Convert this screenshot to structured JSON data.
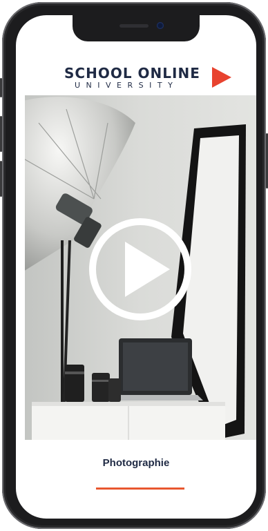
{
  "logo": {
    "main": "SCHOOL ONLINE",
    "sub": "UNIVERSITY",
    "accent_color": "#e8432f"
  },
  "video": {
    "play_icon": "play-circle-icon"
  },
  "course": {
    "title": "Photographie",
    "accent_color": "#e8572f"
  }
}
